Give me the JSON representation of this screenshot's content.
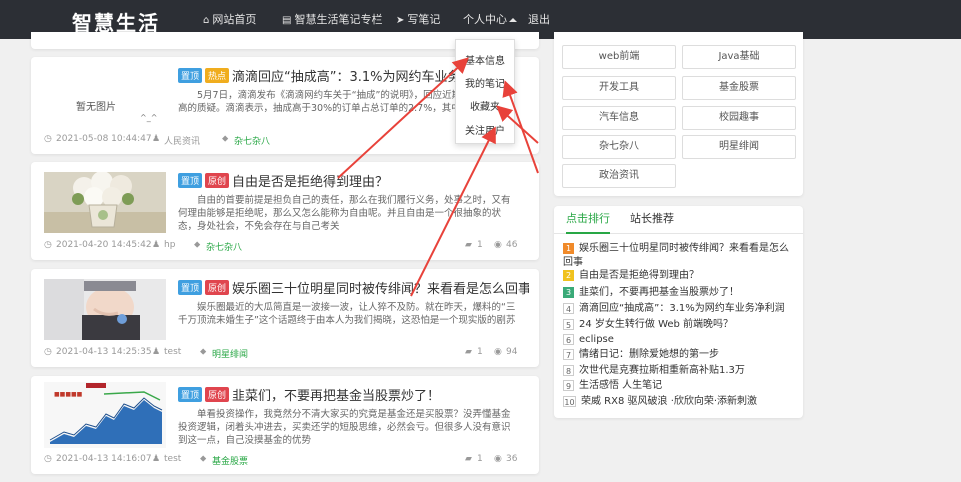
{
  "site": {
    "logo": "智慧生活"
  },
  "nav": {
    "items": [
      {
        "icon": "home-icon",
        "glyph": "⌂",
        "label": "网站首页"
      },
      {
        "icon": "file-icon",
        "glyph": "▤",
        "label": "智慧生活笔记专栏"
      },
      {
        "icon": "send-icon",
        "glyph": "➤",
        "label": "写笔记"
      },
      {
        "label": "个人中心"
      },
      {
        "label": "退出"
      }
    ]
  },
  "dropdown": {
    "items": [
      "基本信息",
      "我的笔记",
      "收藏夹",
      "关注用户"
    ]
  },
  "articles": [
    {
      "image_text": "暂无图片",
      "image_subtext": "^_^",
      "badges": [
        "置顶",
        "热点"
      ],
      "title": "滴滴回应“抽成高”：3.1%为网约车业务净利润",
      "excerpt": "5月7日，滴滴发布《滴滴网约车关于“抽成”的说明》，回应近期网约车抽成高的质疑。滴滴表示，抽成高于30%的订单占总订单的2.7%，其中包括高",
      "date": "2021-05-08 10:44:47",
      "author": "人民资讯",
      "tag": "杂七杂八",
      "comments": "",
      "views": ""
    },
    {
      "badges": [
        "置顶",
        "原创"
      ],
      "title": "自由是否是拒绝得到理由？",
      "excerpt": "自由的首要前提是担负自己的责任，那么在我们履行义务，处事之时，又有何理由能够是拒绝呢，那么又怎么能称为自由呢。并且自由是一个很抽象的状态，身处社会，不免会存在与自己考关",
      "date": "2021-04-20 14:45:42",
      "author": "hp",
      "tag": "杂七杂八",
      "comments": "1",
      "views": "46"
    },
    {
      "badges": [
        "置顶",
        "原创"
      ],
      "title": "娱乐圈三十位明星同时被传绯闻？来看看是怎么回事",
      "excerpt": "娱乐圈最近的大瓜简直是一波接一波，让人猝不及防。就在昨天，爆料的“三千万顶流未婚生子”这个话题终于由本人为我们揭晓，这恐怕是一个现实版的剧苏",
      "date": "2021-04-13 14:25:35",
      "author": "test",
      "tag": "明星绯闻",
      "comments": "1",
      "views": "94"
    },
    {
      "badges": [
        "置顶",
        "原创"
      ],
      "title": "韭菜们，不要再把基金当股票炒了！",
      "excerpt": "单看投资操作，我竟然分不清大家买的究竟是基金还是买股票？没弄懂基金投资逻辑，闭着头冲进去，买卖还学的短股思维，必然会亏。但很多人没有意识到这一点，自己没摸基金的优势",
      "date": "2021-04-13 14:16:07",
      "author": "test",
      "tag": "基金股票",
      "comments": "1",
      "views": "36"
    }
  ],
  "categories": [
    "web前端",
    "Java基础",
    "开发工具",
    "基金股票",
    "汽车信息",
    "校园趣事",
    "杂七杂八",
    "明星绯闻",
    "政治资讯"
  ],
  "ranking": {
    "tabs": [
      "点击排行",
      "站长推荐"
    ],
    "items": [
      "娱乐圈三十位明星同时被传绯闻？来看看是怎么回事",
      "自由是否是拒绝得到理由？",
      "韭菜们，不要再把基金当股票炒了！",
      "滴滴回应“抽成高”：3.1%为网约车业务净利润",
      "24 岁女生转行做 Web 前端晚吗？",
      "eclipse",
      "情绪日记：删除爱她想的第一步",
      "次世代是克赛拉斯相重新高补贴1.3万",
      "生活感悟 人生笔记",
      "荣威 RX8 驱风破浪 ·欣欣向荣·添新刺激"
    ]
  },
  "colors": {
    "nav_bg": "#2c2f35",
    "accent_green": "#28a745",
    "annotation_red": "#e8423a"
  }
}
